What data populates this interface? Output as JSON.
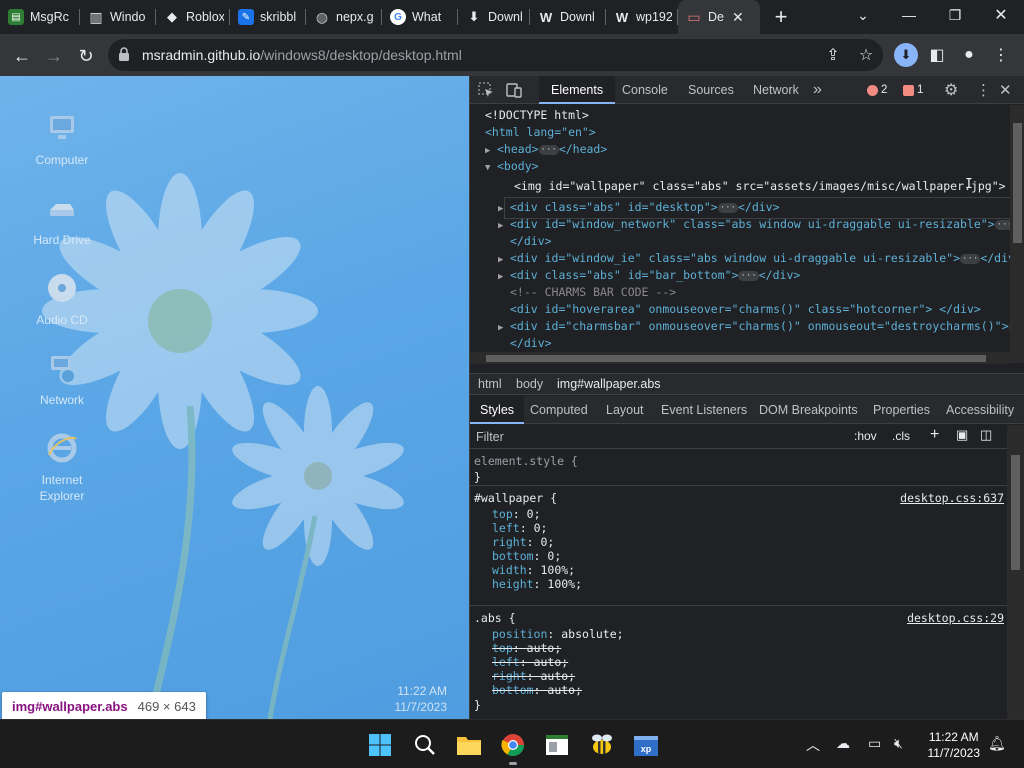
{
  "browser": {
    "tabs": [
      {
        "title": "MsgRc",
        "fav_color": "#2e7d32",
        "fav_glyph": "▤"
      },
      {
        "title": "Windo",
        "fav_color": "#3c4043",
        "fav_glyph": "▥"
      },
      {
        "title": "Roblox",
        "fav_color": "#3c4043",
        "fav_glyph": "◆"
      },
      {
        "title": "skribbl",
        "fav_color": "#1a73e8",
        "fav_glyph": "✎"
      },
      {
        "title": "nepx.g",
        "fav_color": "#5f6368",
        "fav_glyph": "◍"
      },
      {
        "title": "What",
        "fav_color": "#ffffff",
        "fav_glyph": "G"
      },
      {
        "title": "Downl",
        "fav_color": "#3c4043",
        "fav_glyph": "⬇"
      },
      {
        "title": "Downl",
        "fav_color": "#3c4043",
        "fav_glyph": "W"
      },
      {
        "title": "wp192",
        "fav_color": "#3c4043",
        "fav_glyph": "W"
      },
      {
        "title": "De",
        "fav_color": "#c62828",
        "fav_glyph": "▭",
        "active": true
      }
    ],
    "url_host": "msradmin.github.io",
    "url_path": "/windows8/desktop/desktop.html"
  },
  "desktop": {
    "icons": [
      {
        "label": "Computer"
      },
      {
        "label": "Hard Drive"
      },
      {
        "label": "Audio CD"
      },
      {
        "label": "Network"
      },
      {
        "label": "Internet Explorer"
      }
    ],
    "clock_time": "11:22 AM",
    "clock_date": "11/7/2023"
  },
  "tooltip": {
    "selector": "img#wallpaper.abs",
    "size": "469 × 643"
  },
  "devtools": {
    "tabs": [
      "Elements",
      "Console",
      "Sources",
      "Network"
    ],
    "more_tabs": "»",
    "errors": "2",
    "issues": "1",
    "breadcrumbs": [
      "html",
      "body",
      "img#wallpaper.abs"
    ],
    "subtabs": [
      "Styles",
      "Computed",
      "Layout",
      "Event Listeners",
      "DOM Breakpoints",
      "Properties",
      "Accessibility"
    ],
    "filter_placeholder": "Filter",
    "hov": ":hov",
    "cls": ".cls",
    "dom": {
      "doctype": "<!DOCTYPE html>",
      "html_open": "<html lang=\"en\">",
      "head": "<head>",
      "head_close": "</head>",
      "body": "<body>",
      "img_line": "<img id=\"wallpaper\" class=\"abs\" src=\"assets/images/misc/wallpaper.jpg\">",
      "desktop_div": "<div class=\"abs\" id=\"desktop\">",
      "div_close": "</div>",
      "network_div": "<div id=\"window_network\" class=\"abs window ui-draggable ui-resizable\">",
      "ie_div": "<div id=\"window_ie\" class=\"abs window ui-draggable ui-resizable\">",
      "bar_div": "<div class=\"abs\" id=\"bar_bottom\">",
      "comment": "<!-- CHARMS BAR CODE -->",
      "hover_div": "<div id=\"hoverarea\" onmouseover=\"charms()\" class=\"hotcorner\"> </div>",
      "charms_div": "<div id=\"charmsbar\" onmouseover=\"charms()\" onmouseout=\"destroycharms()\">"
    },
    "styles": {
      "element_style": "element.style {",
      "close": "}",
      "wallpaper_selector": "#wallpaper {",
      "wallpaper_src": "desktop.css:637",
      "wallpaper_props": [
        {
          "name": "top",
          "value": "0;"
        },
        {
          "name": "left",
          "value": "0;"
        },
        {
          "name": "right",
          "value": "0;"
        },
        {
          "name": "bottom",
          "value": "0;"
        },
        {
          "name": "width",
          "value": "100%;"
        },
        {
          "name": "height",
          "value": "100%;"
        }
      ],
      "abs_selector": ".abs {",
      "abs_src": "desktop.css:29",
      "abs_props": [
        {
          "name": "position",
          "value": "absolute;",
          "struck": false
        },
        {
          "name": "top",
          "value": "auto;",
          "struck": true
        },
        {
          "name": "left",
          "value": "auto;",
          "struck": true
        },
        {
          "name": "right",
          "value": "auto;",
          "struck": true
        },
        {
          "name": "bottom",
          "value": "auto;",
          "struck": true
        }
      ]
    }
  },
  "taskbar": {
    "time": "11:22 AM",
    "date": "11/7/2023"
  }
}
